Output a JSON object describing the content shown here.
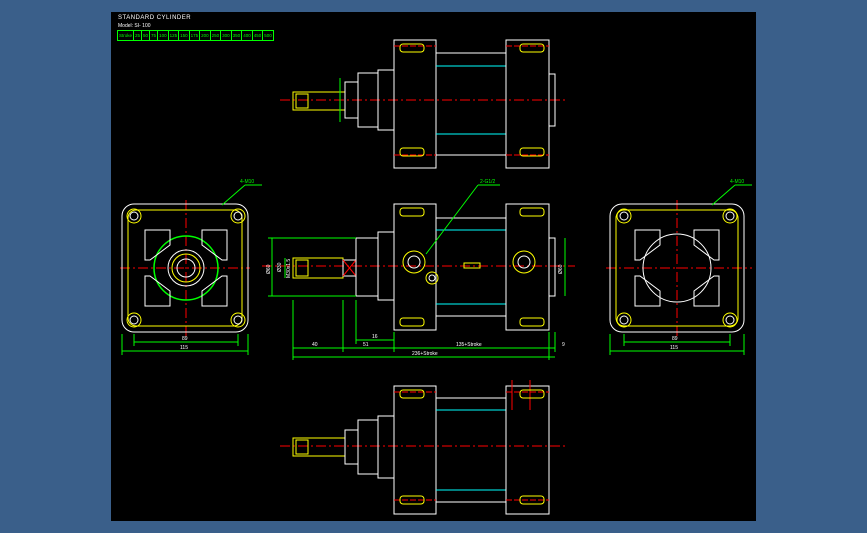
{
  "header": {
    "title": "STANDARD CYLINDER",
    "model": "Model: SI- 100",
    "stroke_cells": [
      "Stroke",
      "25",
      "50",
      "75",
      "100",
      "125",
      "150",
      "175",
      "200",
      "250",
      "300",
      "350",
      "400",
      "450",
      "500"
    ]
  },
  "colors": {
    "background": "#3a5f8a",
    "canvas": "#000000",
    "outline": "#ffffff",
    "dimension": "#00ff00",
    "centerline": "#ff0000",
    "hidden": "#00ffff",
    "accent": "#ffff00"
  },
  "annotations": {
    "left_port_note": "4-M10",
    "right_port_note": "4-M10",
    "center_port_note": "2-G1/2",
    "left_width_inner": "89",
    "left_width_outer": "115",
    "right_width_inner": "89",
    "right_width_outer": "115",
    "dim_rod": "40",
    "dim_51": "51",
    "dim_16": "16",
    "dim_body": "135+Stroke",
    "dim_total": "236+Stroke",
    "dim_end": "9",
    "dim_rod_dia": "M30x1.5",
    "dim_bore": "Ø30",
    "dim_ext": "Ø60",
    "dim_boss": "Ø60"
  }
}
